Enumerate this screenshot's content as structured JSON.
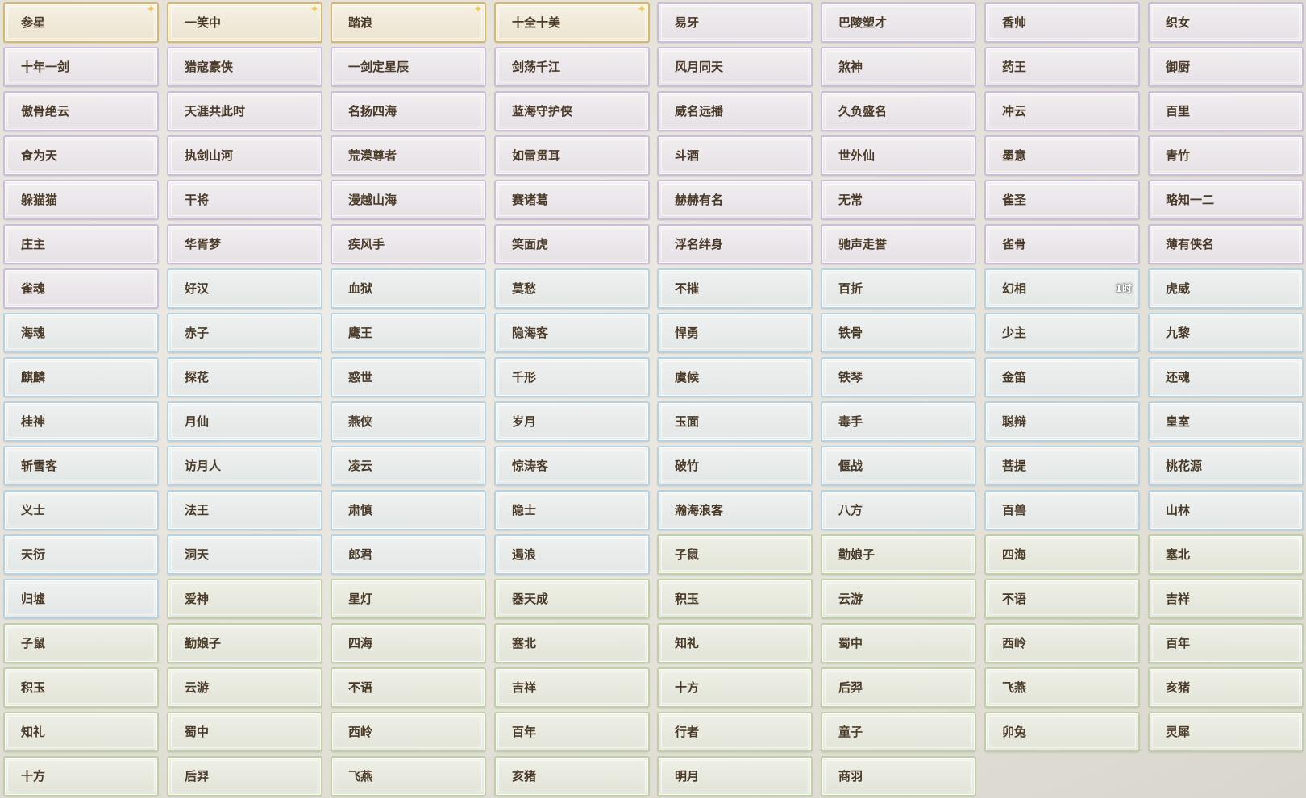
{
  "colors": {
    "gold": "#d9b66a",
    "purple": "#cbbcdb",
    "blue": "#b5d2e3",
    "green": "#bfd0a6",
    "text": "#4a3a28"
  },
  "items": [
    {
      "label": "参星",
      "tier": "gold",
      "icon": "sparkle-icon"
    },
    {
      "label": "一笑中",
      "tier": "gold",
      "icon": "sparkle-icon"
    },
    {
      "label": "踏浪",
      "tier": "gold",
      "icon": "sparkle-icon"
    },
    {
      "label": "十全十美",
      "tier": "gold",
      "icon": "sparkle-icon"
    },
    {
      "label": "易牙",
      "tier": "purple"
    },
    {
      "label": "巴陵塑才",
      "tier": "purple"
    },
    {
      "label": "香帅",
      "tier": "purple"
    },
    {
      "label": "织女",
      "tier": "purple"
    },
    {
      "label": "十年一剑",
      "tier": "purple"
    },
    {
      "label": "猎寇豪侠",
      "tier": "purple"
    },
    {
      "label": "一剑定星辰",
      "tier": "purple"
    },
    {
      "label": "剑荡千江",
      "tier": "purple"
    },
    {
      "label": "风月同天",
      "tier": "purple"
    },
    {
      "label": "煞神",
      "tier": "purple"
    },
    {
      "label": "药王",
      "tier": "purple"
    },
    {
      "label": "御厨",
      "tier": "purple"
    },
    {
      "label": "傲骨绝云",
      "tier": "purple"
    },
    {
      "label": "天涯共此时",
      "tier": "purple"
    },
    {
      "label": "名扬四海",
      "tier": "purple"
    },
    {
      "label": "蓝海守护侠",
      "tier": "purple"
    },
    {
      "label": "威名远播",
      "tier": "purple"
    },
    {
      "label": "久负盛名",
      "tier": "purple"
    },
    {
      "label": "冲云",
      "tier": "purple"
    },
    {
      "label": "百里",
      "tier": "purple"
    },
    {
      "label": "食为天",
      "tier": "purple"
    },
    {
      "label": "执剑山河",
      "tier": "purple"
    },
    {
      "label": "荒漠尊者",
      "tier": "purple"
    },
    {
      "label": "如雷贯耳",
      "tier": "purple"
    },
    {
      "label": "斗酒",
      "tier": "purple"
    },
    {
      "label": "世外仙",
      "tier": "purple"
    },
    {
      "label": "墨意",
      "tier": "purple"
    },
    {
      "label": "青竹",
      "tier": "purple"
    },
    {
      "label": "躲猫猫",
      "tier": "purple"
    },
    {
      "label": "干将",
      "tier": "purple"
    },
    {
      "label": "漫越山海",
      "tier": "purple"
    },
    {
      "label": "赛诸葛",
      "tier": "purple"
    },
    {
      "label": "赫赫有名",
      "tier": "purple"
    },
    {
      "label": "无常",
      "tier": "purple"
    },
    {
      "label": "雀圣",
      "tier": "purple"
    },
    {
      "label": "略知一二",
      "tier": "purple"
    },
    {
      "label": "庄主",
      "tier": "purple"
    },
    {
      "label": "华胥梦",
      "tier": "purple"
    },
    {
      "label": "疾风手",
      "tier": "purple"
    },
    {
      "label": "笑面虎",
      "tier": "purple"
    },
    {
      "label": "浮名绊身",
      "tier": "purple"
    },
    {
      "label": "驰声走誉",
      "tier": "purple"
    },
    {
      "label": "雀骨",
      "tier": "purple"
    },
    {
      "label": "薄有侠名",
      "tier": "purple"
    },
    {
      "label": "雀魂",
      "tier": "purple"
    },
    {
      "label": "好汉",
      "tier": "blue"
    },
    {
      "label": "血狱",
      "tier": "blue"
    },
    {
      "label": "莫愁",
      "tier": "blue"
    },
    {
      "label": "不摧",
      "tier": "blue"
    },
    {
      "label": "百折",
      "tier": "blue"
    },
    {
      "label": "幻相",
      "tier": "blue",
      "badge": "1时"
    },
    {
      "label": "虎威",
      "tier": "blue"
    },
    {
      "label": "海魂",
      "tier": "blue"
    },
    {
      "label": "赤子",
      "tier": "blue"
    },
    {
      "label": "鹰王",
      "tier": "blue"
    },
    {
      "label": "隐海客",
      "tier": "blue"
    },
    {
      "label": "悍勇",
      "tier": "blue"
    },
    {
      "label": "铁骨",
      "tier": "blue"
    },
    {
      "label": "少主",
      "tier": "blue"
    },
    {
      "label": "九黎",
      "tier": "blue"
    },
    {
      "label": "麒麟",
      "tier": "blue"
    },
    {
      "label": "探花",
      "tier": "blue"
    },
    {
      "label": "惑世",
      "tier": "blue"
    },
    {
      "label": "千形",
      "tier": "blue"
    },
    {
      "label": "虞候",
      "tier": "blue"
    },
    {
      "label": "铁琴",
      "tier": "blue"
    },
    {
      "label": "金笛",
      "tier": "blue"
    },
    {
      "label": "还魂",
      "tier": "blue"
    },
    {
      "label": "桂神",
      "tier": "blue"
    },
    {
      "label": "月仙",
      "tier": "blue"
    },
    {
      "label": "燕侠",
      "tier": "blue"
    },
    {
      "label": "岁月",
      "tier": "blue"
    },
    {
      "label": "玉面",
      "tier": "blue"
    },
    {
      "label": "毒手",
      "tier": "blue"
    },
    {
      "label": "聪辩",
      "tier": "blue"
    },
    {
      "label": "皇室",
      "tier": "blue"
    },
    {
      "label": "斩雪客",
      "tier": "blue"
    },
    {
      "label": "访月人",
      "tier": "blue"
    },
    {
      "label": "凌云",
      "tier": "blue"
    },
    {
      "label": "惊涛客",
      "tier": "blue"
    },
    {
      "label": "破竹",
      "tier": "blue"
    },
    {
      "label": "偃战",
      "tier": "blue"
    },
    {
      "label": "菩提",
      "tier": "blue"
    },
    {
      "label": "桃花源",
      "tier": "blue"
    },
    {
      "label": "义士",
      "tier": "blue"
    },
    {
      "label": "法王",
      "tier": "blue"
    },
    {
      "label": "肃慎",
      "tier": "blue"
    },
    {
      "label": "隐士",
      "tier": "blue"
    },
    {
      "label": "瀚海浪客",
      "tier": "blue"
    },
    {
      "label": "八方",
      "tier": "blue"
    },
    {
      "label": "百兽",
      "tier": "blue"
    },
    {
      "label": "山林",
      "tier": "blue"
    },
    {
      "label": "天衍",
      "tier": "blue"
    },
    {
      "label": "洞天",
      "tier": "blue"
    },
    {
      "label": "郎君",
      "tier": "blue"
    },
    {
      "label": "遏浪",
      "tier": "blue"
    },
    {
      "label": "子鼠",
      "tier": "green"
    },
    {
      "label": "勤娘子",
      "tier": "green"
    },
    {
      "label": "四海",
      "tier": "green"
    },
    {
      "label": "塞北",
      "tier": "green"
    },
    {
      "label": "归墟",
      "tier": "blue"
    },
    {
      "label": "爱神",
      "tier": "green"
    },
    {
      "label": "星灯",
      "tier": "green"
    },
    {
      "label": "器天成",
      "tier": "green"
    },
    {
      "label": "积玉",
      "tier": "green"
    },
    {
      "label": "云游",
      "tier": "green"
    },
    {
      "label": "不语",
      "tier": "green"
    },
    {
      "label": "吉祥",
      "tier": "green"
    },
    {
      "label": "子鼠",
      "tier": "green"
    },
    {
      "label": "勤娘子",
      "tier": "green"
    },
    {
      "label": "四海",
      "tier": "green"
    },
    {
      "label": "塞北",
      "tier": "green"
    },
    {
      "label": "知礼",
      "tier": "green"
    },
    {
      "label": "蜀中",
      "tier": "green"
    },
    {
      "label": "西岭",
      "tier": "green"
    },
    {
      "label": "百年",
      "tier": "green"
    },
    {
      "label": "积玉",
      "tier": "green"
    },
    {
      "label": "云游",
      "tier": "green"
    },
    {
      "label": "不语",
      "tier": "green"
    },
    {
      "label": "吉祥",
      "tier": "green"
    },
    {
      "label": "十方",
      "tier": "green"
    },
    {
      "label": "后羿",
      "tier": "green"
    },
    {
      "label": "飞燕",
      "tier": "green"
    },
    {
      "label": "亥猪",
      "tier": "green"
    },
    {
      "label": "知礼",
      "tier": "green"
    },
    {
      "label": "蜀中",
      "tier": "green"
    },
    {
      "label": "西岭",
      "tier": "green"
    },
    {
      "label": "百年",
      "tier": "green"
    },
    {
      "label": "行者",
      "tier": "green"
    },
    {
      "label": "童子",
      "tier": "green"
    },
    {
      "label": "卯兔",
      "tier": "green"
    },
    {
      "label": "灵犀",
      "tier": "green"
    },
    {
      "label": "十方",
      "tier": "green"
    },
    {
      "label": "后羿",
      "tier": "green"
    },
    {
      "label": "飞燕",
      "tier": "green"
    },
    {
      "label": "亥猪",
      "tier": "green"
    },
    {
      "label": "明月",
      "tier": "green"
    },
    {
      "label": "商羽",
      "tier": "green"
    }
  ]
}
